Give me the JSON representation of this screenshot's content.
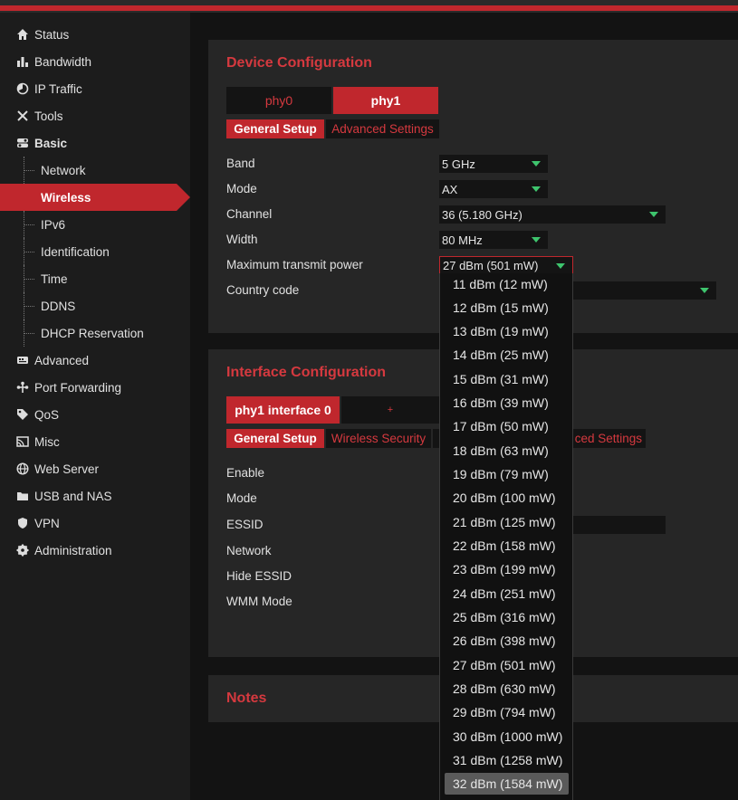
{
  "sidebar": {
    "items": [
      {
        "label": "Status",
        "icon": "home-icon"
      },
      {
        "label": "Bandwidth",
        "icon": "bar-chart-icon"
      },
      {
        "label": "IP Traffic",
        "icon": "pie-chart-icon"
      },
      {
        "label": "Tools",
        "icon": "tools-icon"
      },
      {
        "label": "Basic",
        "icon": "toggle-icon"
      },
      {
        "label": "Advanced",
        "icon": "router-icon"
      },
      {
        "label": "Port Forwarding",
        "icon": "network-icon"
      },
      {
        "label": "QoS",
        "icon": "tag-icon"
      },
      {
        "label": "Misc",
        "icon": "cast-icon"
      },
      {
        "label": "Web Server",
        "icon": "globe-icon"
      },
      {
        "label": "USB and NAS",
        "icon": "folder-icon"
      },
      {
        "label": "VPN",
        "icon": "shield-icon"
      },
      {
        "label": "Administration",
        "icon": "gear-icon"
      }
    ],
    "basic_sub": [
      "Network",
      "Wireless",
      "IPv6",
      "Identification",
      "Time",
      "DDNS",
      "DHCP Reservation"
    ]
  },
  "device": {
    "title": "Device Configuration",
    "tabs": [
      "phy0",
      "phy1"
    ],
    "subtabs": [
      "General Setup",
      "Advanced Settings"
    ],
    "fields": {
      "band": {
        "label": "Band",
        "value": "5 GHz"
      },
      "mode": {
        "label": "Mode",
        "value": "AX"
      },
      "channel": {
        "label": "Channel",
        "value": "36 (5.180 GHz)"
      },
      "width": {
        "label": "Width",
        "value": "80 MHz"
      },
      "power": {
        "label": "Maximum transmit power",
        "value": "27 dBm (501 mW)"
      },
      "country": {
        "label": "Country code",
        "value": ""
      }
    }
  },
  "interface": {
    "title": "Interface Configuration",
    "tabs": [
      "phy1 interface 0",
      "+"
    ],
    "subtabs": [
      "General Setup",
      "Wireless Security",
      "ced Settings"
    ],
    "labels": [
      "Enable",
      "Mode",
      "ESSID",
      "Network",
      "Hide ESSID",
      "WMM Mode"
    ]
  },
  "notes": {
    "title": "Notes"
  },
  "power_options": [
    "11 dBm (12 mW)",
    "12 dBm (15 mW)",
    "13 dBm (19 mW)",
    "14 dBm (25 mW)",
    "15 dBm (31 mW)",
    "16 dBm (39 mW)",
    "17 dBm (50 mW)",
    "18 dBm (63 mW)",
    "19 dBm (79 mW)",
    "20 dBm (100 mW)",
    "21 dBm (125 mW)",
    "22 dBm (158 mW)",
    "23 dBm (199 mW)",
    "24 dBm (251 mW)",
    "25 dBm (316 mW)",
    "26 dBm (398 mW)",
    "27 dBm (501 mW)",
    "28 dBm (630 mW)",
    "29 dBm (794 mW)",
    "30 dBm (1000 mW)",
    "31 dBm (1258 mW)",
    "32 dBm (1584 mW)"
  ],
  "colors": {
    "accent": "#c0272d",
    "arrow": "#3ec46d"
  }
}
